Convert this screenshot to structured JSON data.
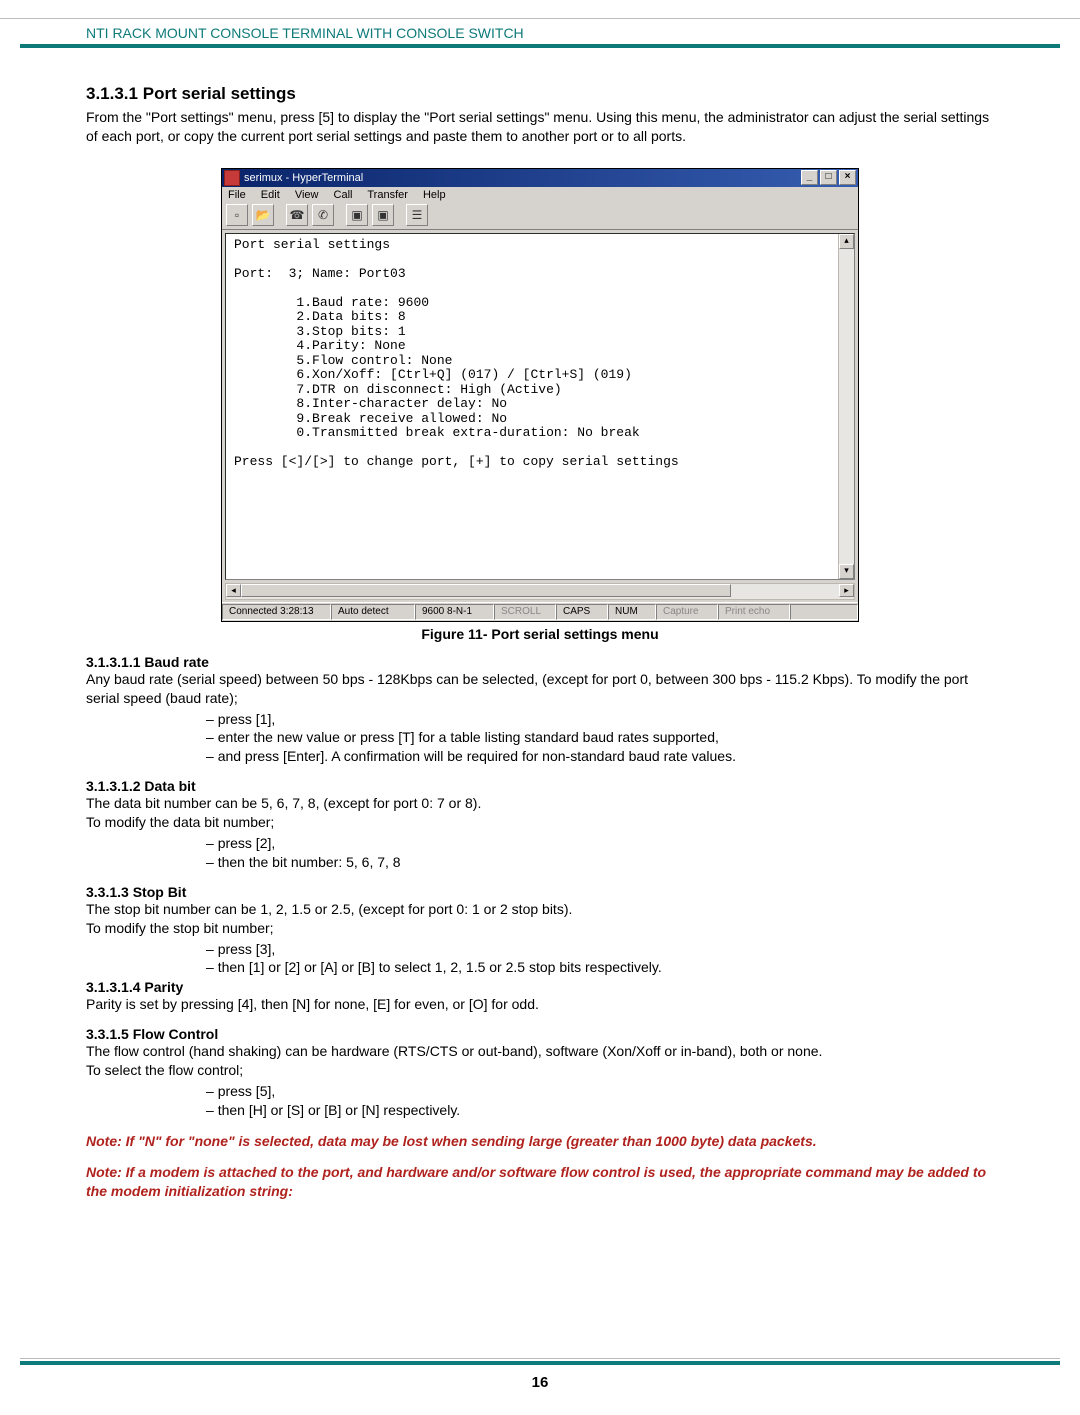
{
  "header": {
    "text": "NTI RACK MOUNT CONSOLE TERMINAL WITH CONSOLE SWITCH"
  },
  "sec1": {
    "num": "3.1.3.1",
    "title": "Port serial settings",
    "intro": "From the \"Port settings\" menu, press [5] to display the \"Port serial settings\" menu. Using this menu, the administrator can adjust the serial settings of each port, or copy the current port serial settings and paste them to another port or to all ports."
  },
  "figure": {
    "caption": "Figure 11- Port serial settings menu"
  },
  "ht": {
    "title": "serimux - HyperTerminal",
    "menus": [
      "File",
      "Edit",
      "View",
      "Call",
      "Transfer",
      "Help"
    ],
    "status": {
      "conn": "Connected 3:28:13",
      "detect": "Auto detect",
      "mode": "9600 8-N-1",
      "scroll": "SCROLL",
      "caps": "CAPS",
      "num": "NUM",
      "capture": "Capture",
      "echo": "Print echo"
    },
    "term": {
      "heading": "Port serial settings",
      "portline": "Port:  3; Name: Port03",
      "l1": "1.Baud rate: 9600",
      "l2": "2.Data bits: 8",
      "l3": "3.Stop bits: 1",
      "l4": "4.Parity: None",
      "l5": "5.Flow control: None",
      "l6": "6.Xon/Xoff: [Ctrl+Q] (017) / [Ctrl+S] (019)",
      "l7": "7.DTR on disconnect: High (Active)",
      "l8": "8.Inter-character delay: No",
      "l9": "9.Break receive allowed: No",
      "l0": "0.Transmitted break extra-duration: No break",
      "prompt": "Press [<]/[>] to change port, [+] to copy serial settings"
    }
  },
  "baud": {
    "heading": "3.1.3.1.1 Baud rate",
    "p1": "Any baud rate (serial speed) between 50 bps - 128Kbps can be selected, (except for port 0,  between 300 bps - 115.2 Kbps). To modify the port serial speed (baud rate);",
    "b1": "press [1],",
    "b2": "enter the new value or press [T] for a table listing standard baud rates supported,",
    "b3": "and press [Enter].    A confirmation will be required for non-standard baud rate values."
  },
  "databit": {
    "heading": "3.1.3.1.2 Data bit",
    "p1": "The data bit number can be 5, 6, 7, 8, (except for port 0:  7 or 8).",
    "p2": "To modify the data bit number;",
    "b1": "press [2],",
    "b2": "then the bit number: 5, 6, 7, 8"
  },
  "stopbit": {
    "heading": "3.3.1.3 Stop Bit",
    "p1": " The stop bit number can be 1, 2, 1.5 or 2.5, (except for port 0: 1 or 2 stop bits).",
    "p2": " To modify the stop bit number;",
    "b1": "press [3],",
    "b2": "then [1] or [2] or [A] or [B] to select 1, 2, 1.5 or 2.5 stop bits respectively."
  },
  "parity": {
    "heading": "3.1.3.1.4 Parity",
    "p1": "Parity is set by pressing [4], then  [N] for none,  [E] for even,  or  [O] for odd."
  },
  "flow": {
    "heading": "3.3.1.5 Flow Control",
    "p1": "The flow control (hand shaking) can be hardware (RTS/CTS or out-band), software (Xon/Xoff or in-band), both or none.",
    "p2": "To select the flow control;",
    "b1": "press [5],",
    "b2": "then [H] or [S] or [B] or [N] respectively."
  },
  "notes": {
    "n1": "Note: If  \"N\" for \"none\" is selected, data may be lost when sending large (greater than 1000 byte) data packets.",
    "n2": "Note: If a modem is attached to the port, and hardware and/or software flow control is used, the appropriate command may be added to the modem initialization string:"
  },
  "page_num": "16"
}
